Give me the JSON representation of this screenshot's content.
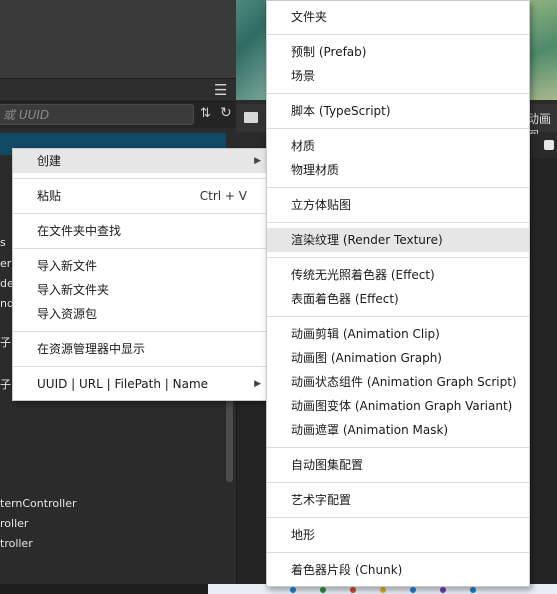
{
  "editor": {
    "search_placeholder": "按名称搜索 或 UUID",
    "search_visible": "或 UUID",
    "right_tab_label": "动画图",
    "tree_fragments": [
      "s",
      "eria",
      "der",
      "nd",
      "子",
      "子",
      "ternController",
      "roller",
      "troller"
    ]
  },
  "left_menu": {
    "items": [
      {
        "label": "创建",
        "submenu": true,
        "highlighted": true
      },
      {
        "separator": true
      },
      {
        "label": "粘贴",
        "shortcut": "Ctrl + V"
      },
      {
        "separator": true
      },
      {
        "label": "在文件夹中查找"
      },
      {
        "separator": true
      },
      {
        "label": "导入新文件"
      },
      {
        "label": "导入新文件夹"
      },
      {
        "label": "导入资源包"
      },
      {
        "separator": true
      },
      {
        "label": "在资源管理器中显示"
      },
      {
        "separator": true
      },
      {
        "label": "UUID | URL | FilePath | Name",
        "submenu": true
      }
    ]
  },
  "right_menu": {
    "items": [
      {
        "label": "文件夹"
      },
      {
        "separator": true
      },
      {
        "label": "预制 (Prefab)"
      },
      {
        "label": "场景"
      },
      {
        "separator": true
      },
      {
        "label": "脚本 (TypeScript)"
      },
      {
        "separator": true
      },
      {
        "label": "材质"
      },
      {
        "label": "物理材质"
      },
      {
        "separator": true
      },
      {
        "label": "立方体贴图"
      },
      {
        "separator": true
      },
      {
        "label": "渲染纹理 (Render Texture)",
        "highlighted": true
      },
      {
        "separator": true
      },
      {
        "label": "传统无光照着色器 (Effect)"
      },
      {
        "label": "表面着色器 (Effect)"
      },
      {
        "separator": true
      },
      {
        "label": "动画剪辑 (Animation Clip)"
      },
      {
        "label": "动画图 (Animation Graph)"
      },
      {
        "label": "动画状态组件 (Animation Graph Script)"
      },
      {
        "label": "动画图变体 (Animation Graph Variant)"
      },
      {
        "label": "动画遮罩 (Animation Mask)"
      },
      {
        "separator": true
      },
      {
        "label": "自动图集配置"
      },
      {
        "separator": true
      },
      {
        "label": "艺术字配置"
      },
      {
        "separator": true
      },
      {
        "label": "地形"
      },
      {
        "separator": true
      },
      {
        "label": "着色器片段 (Chunk)"
      }
    ]
  },
  "colors": {
    "selection": "#124a66",
    "menu_bg": "#ffffff",
    "menu_highlight": "#e6e6e6"
  }
}
